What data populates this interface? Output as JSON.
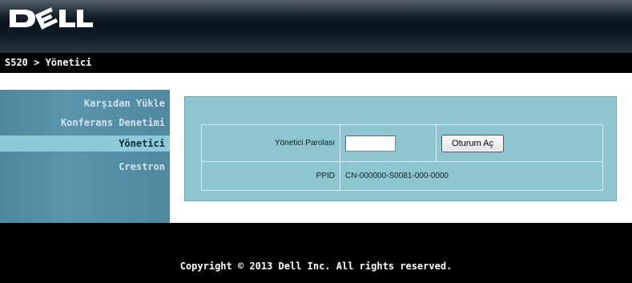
{
  "header": {
    "logo_text": "DELL",
    "breadcrumb": "S520 > Yönetici"
  },
  "sidebar": {
    "items": [
      {
        "label": "Karşıdan Yükle",
        "active": false
      },
      {
        "label": "Konferans Denetimi",
        "active": false
      },
      {
        "label": "Yönetici",
        "active": true
      },
      {
        "label": "Crestron",
        "active": false
      }
    ]
  },
  "form": {
    "password_label": "Yönetici Parolası",
    "password_value": "",
    "login_button": "Oturum Aç",
    "ppid_label": "PPID",
    "ppid_value": "CN-000000-S0081-000-0000"
  },
  "footer": {
    "copyright": "Copyright © 2013 Dell Inc. All rights reserved."
  },
  "colors": {
    "sidebar_bg": "#5a95ad",
    "sidebar_active": "#8ccad8",
    "panel_bg": "#8dc6d0",
    "bars": "#000000"
  }
}
